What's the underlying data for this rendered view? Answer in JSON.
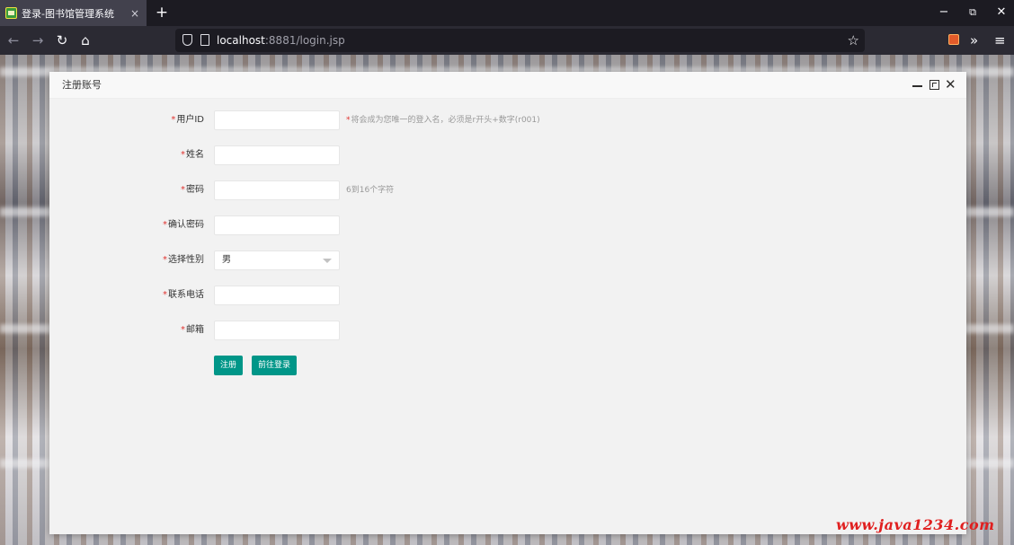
{
  "browser": {
    "tab_title": "登录-图书馆管理系统",
    "tab_close": "×",
    "new_tab": "+",
    "url_host": "localhost",
    "url_rest": ":8881/login.jsp",
    "window_controls": {
      "minimize": "−",
      "restore": "⧉",
      "close": "✕"
    },
    "icons": [
      "back-icon",
      "forward-icon",
      "reload-icon",
      "home-icon",
      "shield-icon",
      "page-icon",
      "star-icon",
      "extension-icon",
      "overflow-icon",
      "menu-icon"
    ]
  },
  "dialog": {
    "title": "注册账号",
    "fields": {
      "user_id": {
        "label": "用户ID",
        "value": "",
        "hint": "将会成为您唯一的登入名，必须是r开头+数字(r001)"
      },
      "name": {
        "label": "姓名",
        "value": ""
      },
      "password": {
        "label": "密码",
        "value": "",
        "hint": "6到16个字符"
      },
      "confirm_password": {
        "label": "确认密码",
        "value": ""
      },
      "gender": {
        "label": "选择性别",
        "value": "男"
      },
      "phone": {
        "label": "联系电话",
        "value": ""
      },
      "email": {
        "label": "邮箱",
        "value": ""
      }
    },
    "required_mark": "*",
    "buttons": {
      "register": "注册",
      "go_login": "前往登录"
    }
  },
  "watermark": "www.java1234.com",
  "colors": {
    "accent": "#009688",
    "required": "#e0322e",
    "chrome_bg": "#1c1b22",
    "dialog_bg": "#f2f2f2"
  }
}
